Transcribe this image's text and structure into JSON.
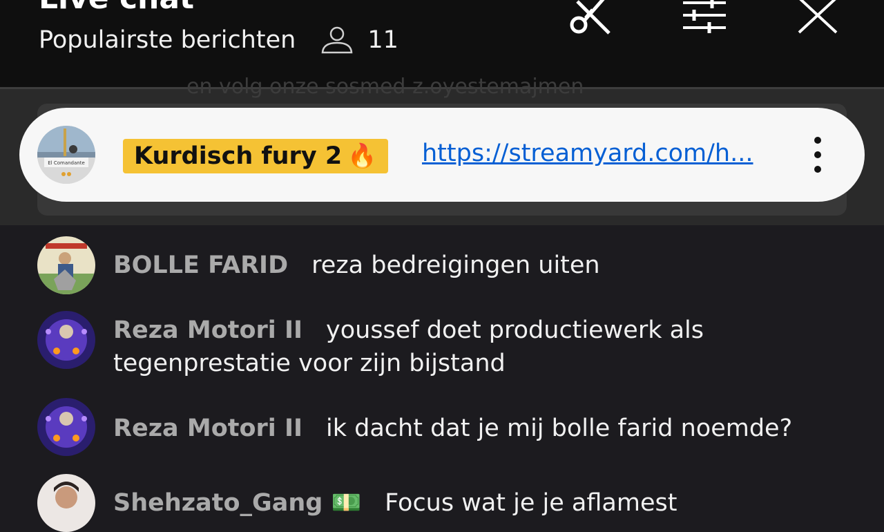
{
  "header": {
    "title": "Live chat",
    "subtitle": "Populairste berichten",
    "viewer_count": "11"
  },
  "pinned": {
    "ghost_text": "en volg onze sosmed z.oyestemajmen",
    "badge": "Kurdisch fury 2",
    "badge_emoji": "🔥",
    "link": "https://streamyard.com/h...",
    "avatar_caption": "El Comandante"
  },
  "messages": [
    {
      "author": "BOLLE FARID",
      "text": "reza bedreigingen uiten"
    },
    {
      "author": "Reza Motori II",
      "text": "youssef doet productiewerk als tegenprestatie voor zijn bijstand"
    },
    {
      "author": "Reza Motori II",
      "text": "ik dacht dat je mij bolle farid noemde?"
    },
    {
      "author": "Shehzato_Gang 💵",
      "text": "Focus wat je je aflamest"
    }
  ],
  "colors": {
    "pin_badge": "#f5c234",
    "link": "#065fd4",
    "author": "#aaaaaa",
    "background": "#1c1b1f"
  }
}
